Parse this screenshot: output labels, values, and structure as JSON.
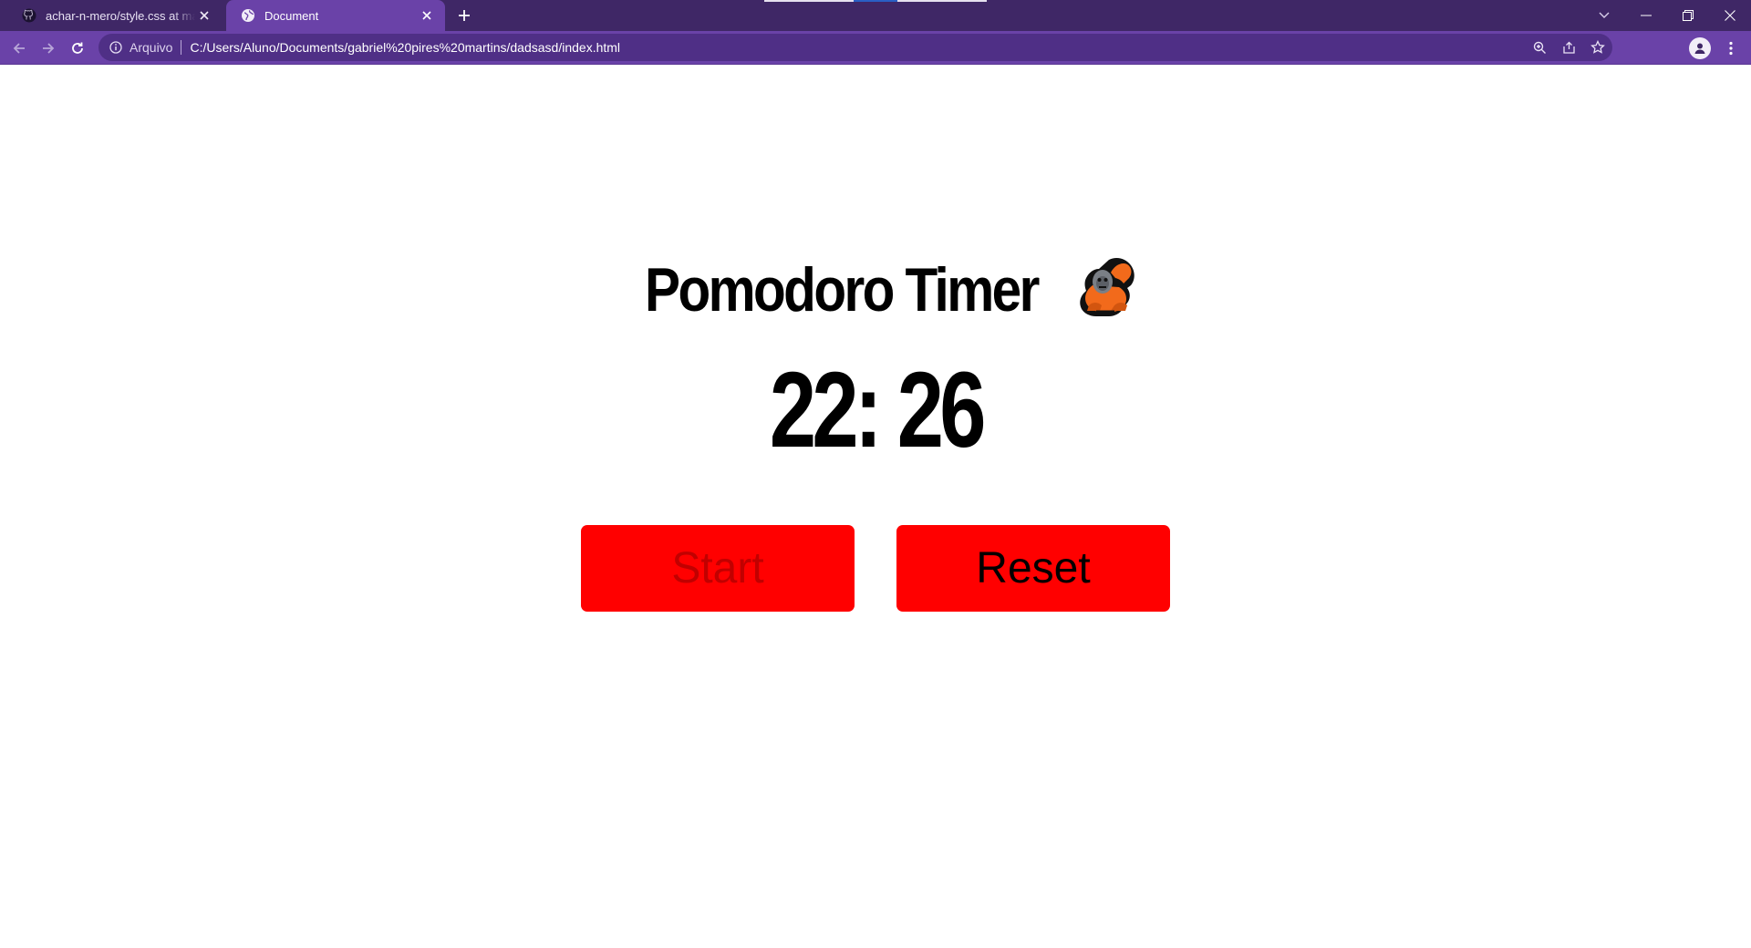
{
  "browser": {
    "tabs": [
      {
        "title": "achar-n-mero/style.css at main · ",
        "favicon": "github-icon",
        "active": false
      },
      {
        "title": "Document",
        "favicon": "globe-icon",
        "active": true
      }
    ],
    "omnibox": {
      "scheme_label": "Arquivo",
      "url": "C:/Users/Aluno/Documents/gabriel%20pires%20martins/dadsasd/index.html"
    }
  },
  "app": {
    "title": "Pomodoro Timer",
    "title_icon": "orangutan-emoji",
    "timer": "22: 26",
    "buttons": {
      "start": "Start",
      "reset": "Reset"
    }
  },
  "colors": {
    "tabstrip": "#3f2766",
    "toolbar": "#6a42a8",
    "button": "#ff0000",
    "start_text": "#c10000",
    "reset_text": "#000000"
  }
}
